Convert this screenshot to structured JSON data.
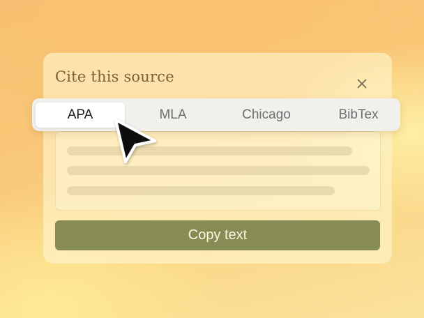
{
  "dialog": {
    "title": "Cite this source",
    "close_icon": "close-icon",
    "copy_button_label": "Copy text"
  },
  "tabs": [
    {
      "label": "APA",
      "active": true
    },
    {
      "label": "MLA",
      "active": false
    },
    {
      "label": "Chicago",
      "active": false
    },
    {
      "label": "BibTex",
      "active": false
    }
  ],
  "cursor_icon": "arrow-pointer-icon",
  "colors": {
    "accent_button": "#868c54",
    "title_text": "#7a6236"
  }
}
